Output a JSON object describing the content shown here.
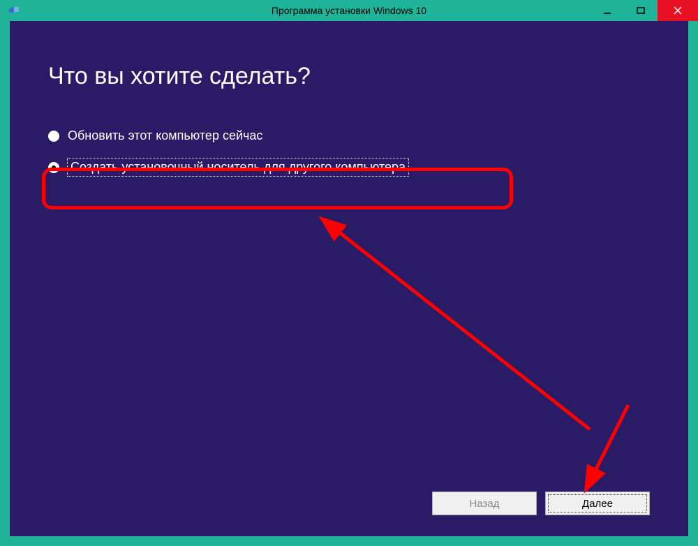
{
  "window": {
    "title": "Программа установки Windows 10"
  },
  "main": {
    "heading": "Что вы хотите сделать?",
    "options": [
      {
        "label": "Обновить этот компьютер сейчас",
        "selected": false
      },
      {
        "label": "Создать установочный носитель для другого компьютера",
        "selected": true
      }
    ]
  },
  "footer": {
    "back_label": "Назад",
    "next_label": "Далее"
  },
  "colors": {
    "accent": "#1fb39a",
    "body_bg": "#2a1b67",
    "annotation": "#ff0000",
    "close_btn": "#e81123"
  }
}
